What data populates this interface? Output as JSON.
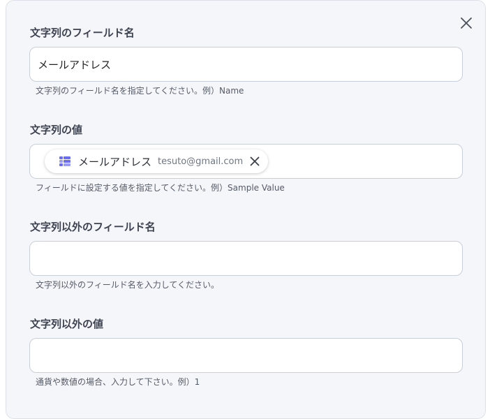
{
  "fields": [
    {
      "label": "文字列のフィールド名",
      "value": "メールアドレス",
      "placeholder": "",
      "hint": "文字列のフィールド名を指定してください。例）Name"
    },
    {
      "label": "文字列の値",
      "chip": {
        "label": "メールアドレス",
        "value": "tesuto@gmail.com",
        "icon": "data-source-icon"
      },
      "hint": "フィールドに設定する値を指定してください。例）Sample Value"
    },
    {
      "label": "文字列以外のフィールド名",
      "value": "",
      "placeholder": "",
      "hint": "文字列以外のフィールド名を入力してください。"
    },
    {
      "label": "文字列以外の値",
      "value": "",
      "placeholder": "",
      "hint": "通貨や数値の場合、入力して下さい。例）1"
    }
  ],
  "icons": {
    "close": "close-icon",
    "chip_remove": "close-icon"
  },
  "colors": {
    "panel_bg": "#f4f6f9",
    "accent": "#6b6cf5",
    "label_text": "#3d4350",
    "input_border": "#c9cfd8"
  }
}
